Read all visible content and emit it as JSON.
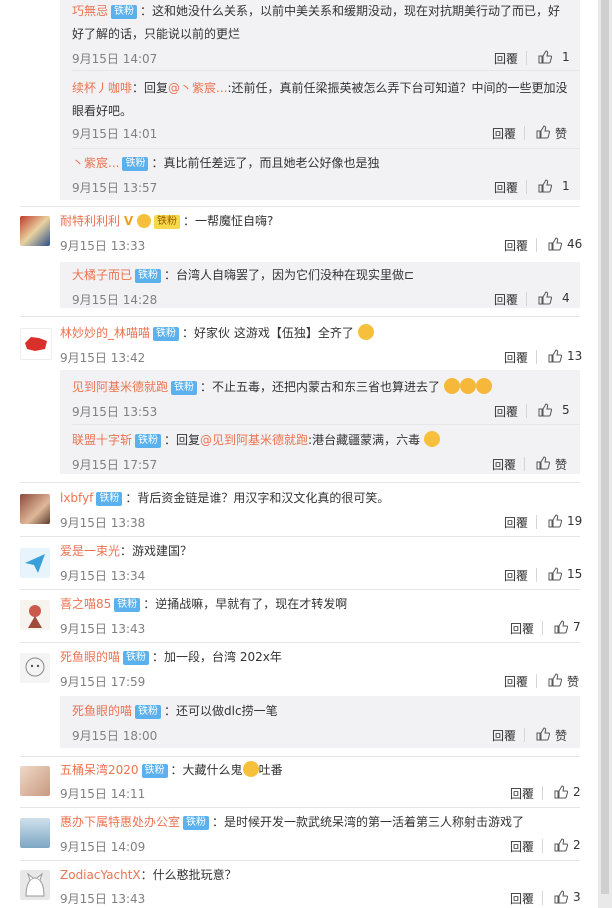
{
  "badge_label": "铁粉",
  "reply_label": "回覆",
  "like_placeholder": "赞",
  "comments": [
    {
      "user": "巧無忌",
      "badge": true,
      "text": "：这和她没什么关系，以前中美关系和缓期没动，现在对抗期美行动了而已，好",
      "text2": "好了解的话，只能说以前的更烂",
      "time": "9月15日 14:07",
      "likes": "1",
      "reply": true
    },
    {
      "user": "续杯丿咖啡",
      "badge": false,
      "pre": "：回复",
      "at": "@丶紫宸...",
      "text": ":还前任，真前任梁振英被怎么弄下台可知道？中间的一些更加没",
      "text2": "眼看好吧。",
      "time": "9月15日 14:01",
      "likes": "",
      "reply": true
    },
    {
      "user": "丶紫宸...",
      "badge": true,
      "text": "：真比前任差远了，而且她老公好像也是独",
      "time": "9月15日 13:57",
      "likes": "1",
      "reply": true
    },
    {
      "user": "耐特利利利",
      "badge": false,
      "text": "：一帮魔怔自嗨?",
      "time": "9月15日 13:33",
      "likes": "46",
      "reply": false
    },
    {
      "user": "大橘子而已",
      "badge": true,
      "text": "：台湾人自嗨罢了，因为它们没种在现实里做⊏",
      "time": "9月15日 14:28",
      "likes": "4",
      "reply": true
    },
    {
      "user": "林妙妙的_林喵喵",
      "badge": true,
      "text": "：好家伙  这游戏【伍独】全齐了",
      "time": "9月15日 13:42",
      "likes": "13",
      "reply": false
    },
    {
      "user": "见到阿基米德就跑",
      "badge": true,
      "text": "：不止五毒，还把内蒙古和东三省也算进去了",
      "time": "9月15日 13:53",
      "likes": "5",
      "reply": true
    },
    {
      "user": "联盟十字斩",
      "badge": true,
      "pre": "：回复",
      "at": "@见到阿基米德就跑",
      "text": ":港台藏疆蒙满，六毒",
      "time": "9月15日 17:57",
      "likes": "",
      "reply": true
    },
    {
      "user": "lxbfyf",
      "badge": true,
      "text": "：背后资金链是谁？用汉字和汉文化真的很可笑。",
      "time": "9月15日 13:38",
      "likes": "19",
      "reply": false
    },
    {
      "user": "爱是一束光",
      "badge": false,
      "text": "：游戏建国？",
      "time": "9月15日 13:34",
      "likes": "15",
      "reply": false
    },
    {
      "user": "喜之喵85",
      "badge": true,
      "text": "：逆捅战嘛，早就有了，现在才转发啊",
      "time": "9月15日 13:43",
      "likes": "7",
      "reply": false
    },
    {
      "user": "死鱼眼的喵",
      "badge": true,
      "text": "：加一段，台湾 202x年",
      "time": "9月15日 17:59",
      "likes": "",
      "reply": false
    },
    {
      "user": "死鱼眼的喵",
      "badge": true,
      "text": "：还可以做dlc捞一笔",
      "time": "9月15日 18:00",
      "likes": "",
      "reply": true
    },
    {
      "user": "五桶呆湾2020",
      "badge": true,
      "text": "：大藏什么鬼",
      "text_tail": "吐番",
      "time": "9月15日 14:11",
      "likes": "2",
      "reply": false
    },
    {
      "user": "惠办下属特惠处办公室",
      "badge": true,
      "text": "：是时候开发一款武统呆湾的第一活着第三人称射击游戏了",
      "time": "9月15日 14:09",
      "likes": "2",
      "reply": false
    },
    {
      "user": "ZodiacYachtX",
      "badge": false,
      "text": "：什么憨批玩意？",
      "time": "9月15日 13:43",
      "likes": "3",
      "reply": false
    }
  ]
}
